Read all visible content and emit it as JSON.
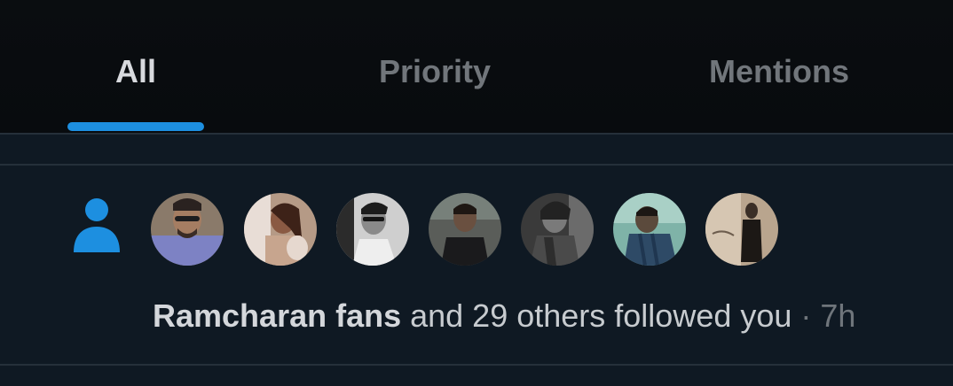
{
  "tabs": [
    {
      "label": "All",
      "active": true
    },
    {
      "label": "Priority",
      "active": false
    },
    {
      "label": "Mentions",
      "active": false
    }
  ],
  "accent_color": "#1d8fe0",
  "notification": {
    "type_icon": "person-icon",
    "avatars": [
      {
        "name": "avatar-1"
      },
      {
        "name": "avatar-2"
      },
      {
        "name": "avatar-3"
      },
      {
        "name": "avatar-4"
      },
      {
        "name": "avatar-5"
      },
      {
        "name": "avatar-6"
      },
      {
        "name": "avatar-7"
      }
    ],
    "actor": "Ramcharan fans",
    "message": " and 29 others followed you",
    "separator": " · ",
    "time": "7h"
  }
}
